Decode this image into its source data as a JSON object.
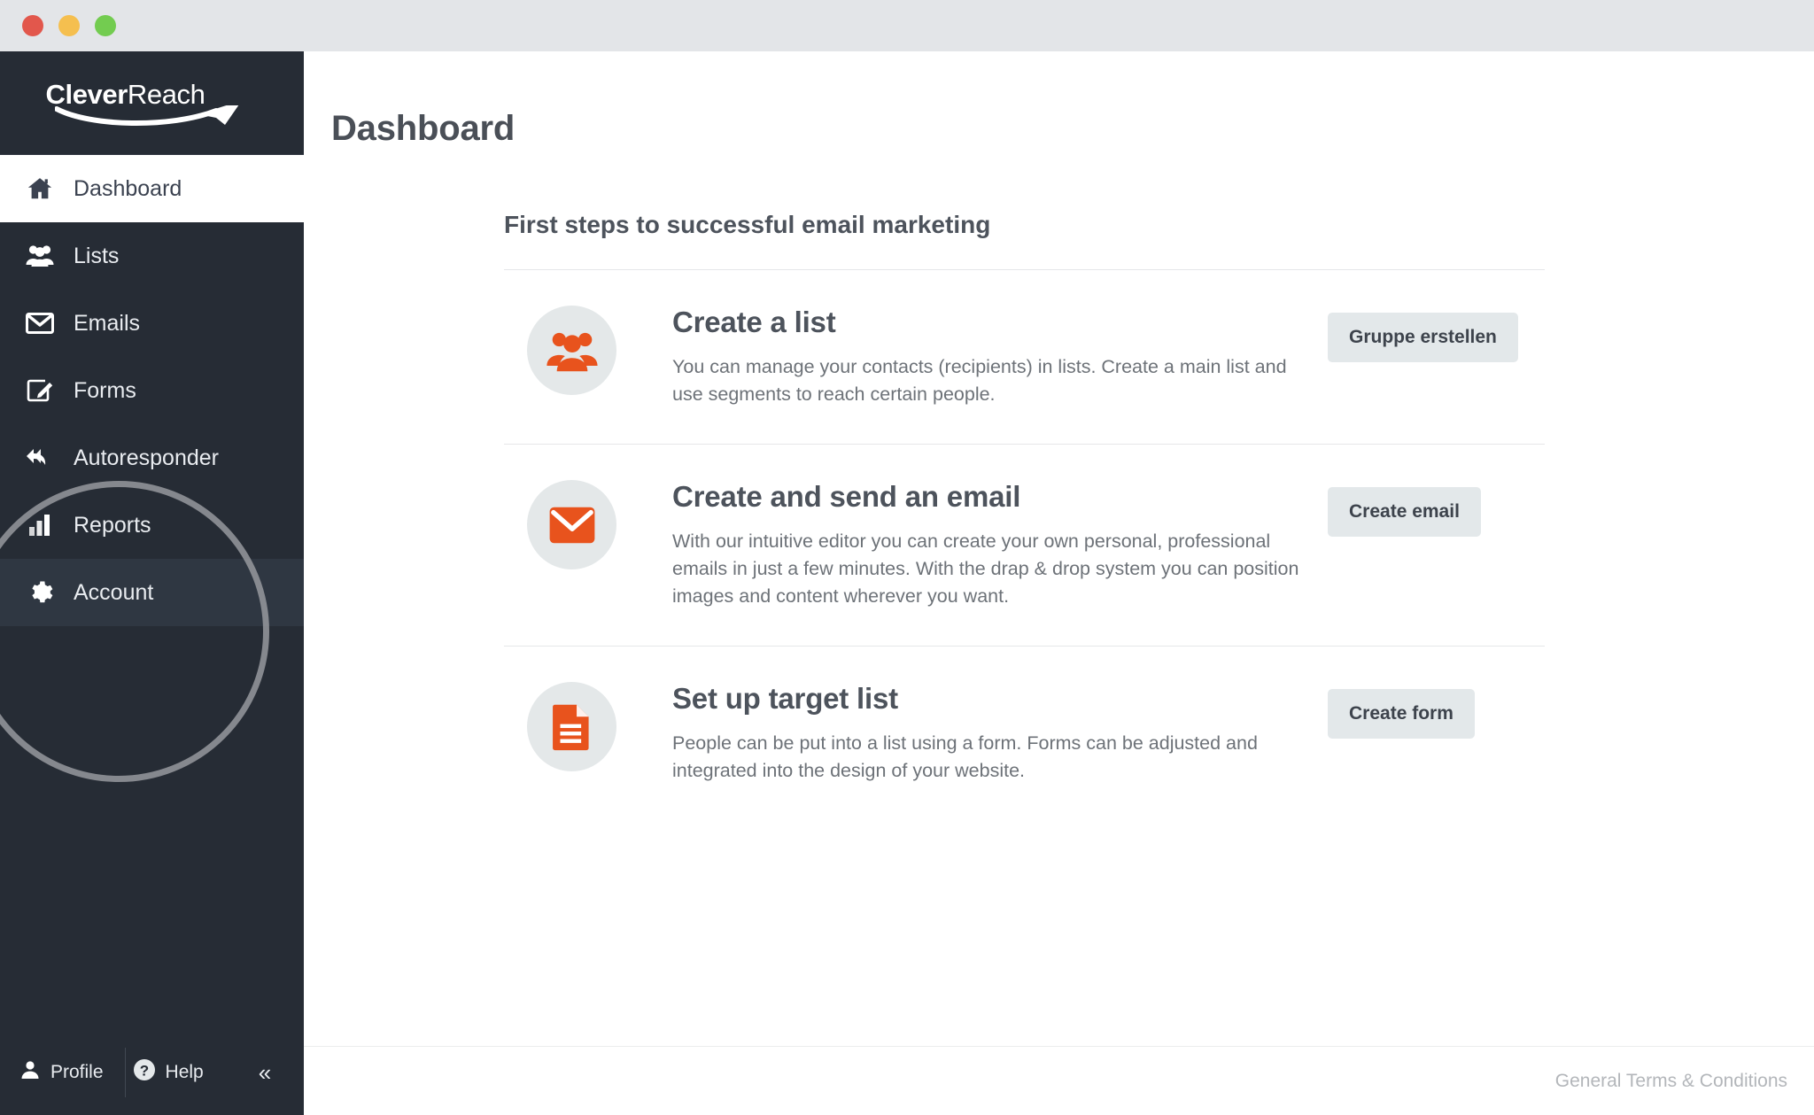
{
  "window": {
    "traffic_lights": [
      "close",
      "minimize",
      "maximize"
    ]
  },
  "brand": {
    "name_bold": "Clever",
    "name_light": "Reach",
    "logo_icon": "paper-plane-swoosh-icon"
  },
  "sidebar": {
    "items": [
      {
        "label": "Dashboard",
        "icon": "home-icon",
        "state": "active"
      },
      {
        "label": "Lists",
        "icon": "users-icon",
        "state": "normal"
      },
      {
        "label": "Emails",
        "icon": "envelope-icon",
        "state": "normal"
      },
      {
        "label": "Forms",
        "icon": "form-edit-icon",
        "state": "normal"
      },
      {
        "label": "Autoresponder",
        "icon": "reply-all-icon",
        "state": "normal"
      },
      {
        "label": "Reports",
        "icon": "bar-chart-icon",
        "state": "normal"
      },
      {
        "label": "Account",
        "icon": "gear-icon",
        "state": "hover"
      }
    ],
    "footer": {
      "profile_label": "Profile",
      "profile_icon": "user-icon",
      "help_label": "Help",
      "help_icon": "question-circle-icon",
      "collapse_icon": "double-chevron-left-icon",
      "collapse_glyph": "«"
    }
  },
  "header": {
    "title": "Dashboard"
  },
  "main": {
    "section_title": "First steps to successful email marketing",
    "cards": [
      {
        "title": "Create a list",
        "description": "You can manage your contacts (recipients) in lists. Create a main list and use segments to reach certain people.",
        "button": "Gruppe erstellen",
        "icon": "users-group-icon"
      },
      {
        "title": "Create and send an email",
        "description": "With our intuitive editor you can create your own personal, professional emails in just a few minutes. With the drap & drop system you can position images and content wherever you want.",
        "button": "Create email",
        "icon": "envelope-icon"
      },
      {
        "title": "Set up target list",
        "description": "People can be put into a list using a form. Forms can be adjusted and integrated into the design of your website.",
        "button": "Create form",
        "icon": "document-lines-icon"
      }
    ]
  },
  "footer": {
    "terms_label": "General Terms & Conditions"
  },
  "annotation": {
    "type": "circle-highlight",
    "target": "Account"
  },
  "colors": {
    "sidebar_bg": "#262c35",
    "sidebar_hover": "#2f3742",
    "accent_orange": "#e8531d",
    "icon_circle_bg": "#e4e8e9",
    "button_bg": "#e3e8ea",
    "title_bar": "#e3e5e8",
    "text_dark": "#4d535c",
    "text_muted": "#6d7278",
    "footer_link": "#b3b6ba"
  }
}
